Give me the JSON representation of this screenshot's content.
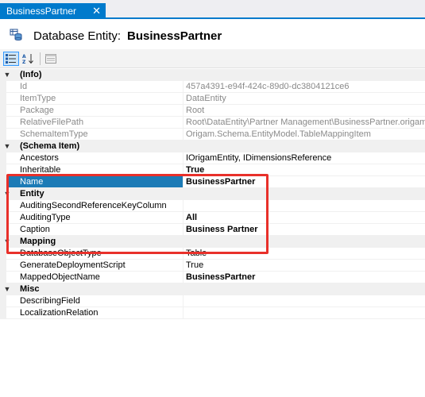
{
  "tab": {
    "label": "BusinessPartner",
    "close_glyph": "✕"
  },
  "header": {
    "prefix": "Database Entity:",
    "name": "BusinessPartner",
    "icon": "database-entity-icon"
  },
  "toolbar": {
    "categorized_icon": "categorized-icon",
    "alphabetical_icon": "sort-alphabetical-icon",
    "property_pages_icon": "property-pages-icon"
  },
  "grid": {
    "categories": [
      {
        "label": "(Info)",
        "rows": [
          {
            "name": "Id",
            "value": "457a4391-e94f-424c-89d0-dc3804121ce6"
          },
          {
            "name": "ItemType",
            "value": "DataEntity"
          },
          {
            "name": "Package",
            "value": "Root"
          },
          {
            "name": "RelativeFilePath",
            "value": "Root\\DataEntity\\Partner Management\\BusinessPartner.origam"
          },
          {
            "name": "SchemaItemType",
            "value": "Origam.Schema.EntityModel.TableMappingItem"
          }
        ]
      },
      {
        "label": "(Schema Item)",
        "rows": [
          {
            "name": "Ancestors",
            "value": "IOrigamEntity, IDimensionsReference"
          },
          {
            "name": "Inheritable",
            "value": "True"
          },
          {
            "name": "Name",
            "value": "BusinessPartner"
          }
        ]
      },
      {
        "label": "Entity",
        "rows": [
          {
            "name": "AuditingSecondReferenceKeyColumn",
            "value": ""
          },
          {
            "name": "AuditingType",
            "value": "All"
          },
          {
            "name": "Caption",
            "value": "Business Partner"
          }
        ]
      },
      {
        "label": "Mapping",
        "rows": [
          {
            "name": "DatabaseObjectType",
            "value": "Table"
          },
          {
            "name": "GenerateDeploymentScript",
            "value": "True"
          },
          {
            "name": "MappedObjectName",
            "value": "BusinessPartner"
          }
        ]
      },
      {
        "label": "Misc",
        "rows": [
          {
            "name": "DescribingField",
            "value": ""
          },
          {
            "name": "LocalizationRelation",
            "value": ""
          }
        ]
      }
    ]
  }
}
